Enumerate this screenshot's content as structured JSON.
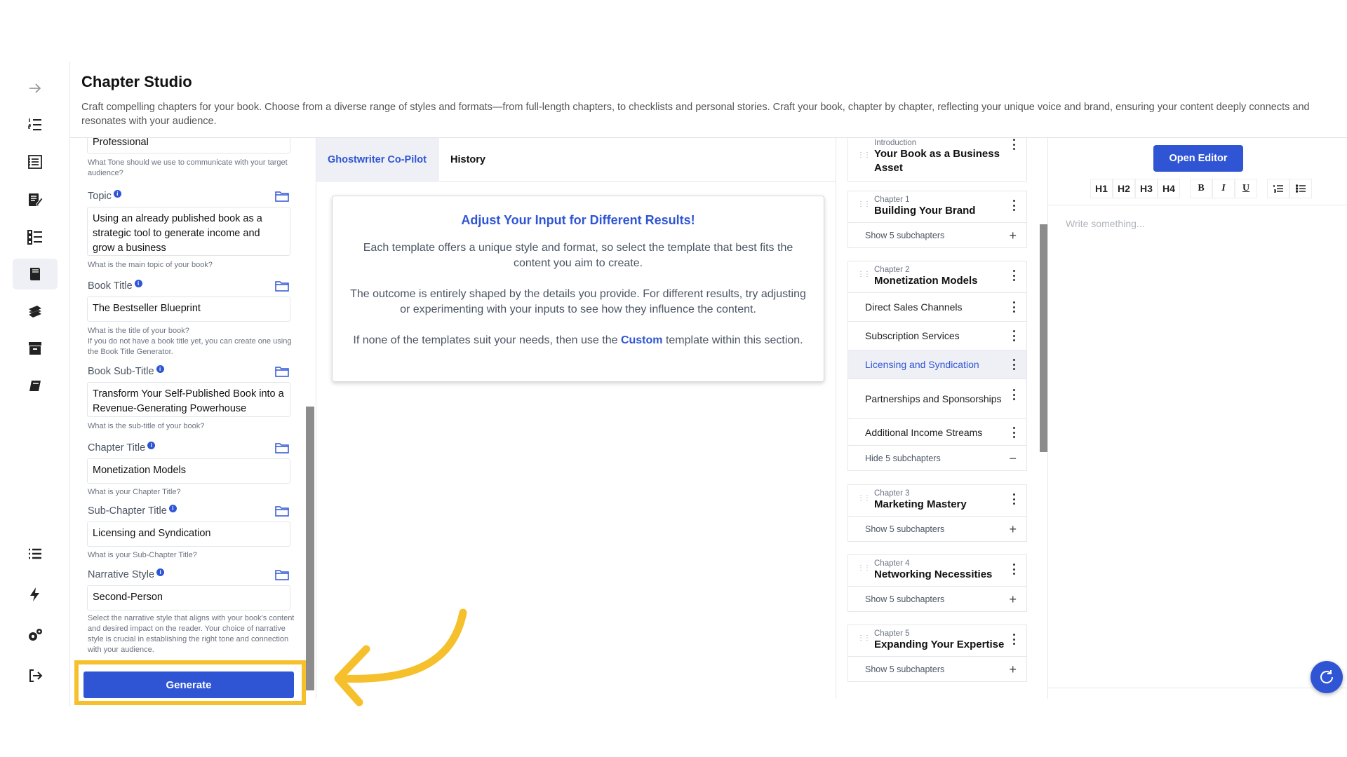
{
  "header": {
    "title": "Chapter Studio",
    "description": "Craft compelling chapters for your book. Choose from a diverse range of styles and formats—from full-length chapters, to checklists and personal stories. Craft your book, chapter by chapter, reflecting your unique voice and brand, ensuring your content deeply connects and resonates with your audience."
  },
  "sidebar": {
    "icons": [
      "arrow-right-icon",
      "numbered-list-icon",
      "document-list-icon",
      "edit-document-icon",
      "checklist-icon",
      "book-open-icon",
      "books-stack-icon",
      "archive-icon",
      "book-icon",
      "menu-list-icon",
      "lightning-icon",
      "settings-icon",
      "logout-icon"
    ]
  },
  "form": {
    "tone": {
      "value": "Professional",
      "hint": "What Tone should we use to communicate with your target audience?"
    },
    "topic": {
      "label": "Topic",
      "value": "Using an already published book as a strategic tool to generate income and grow a business",
      "hint": "What is the main topic of your book?"
    },
    "book_title": {
      "label": "Book Title",
      "value": "The Bestseller Blueprint",
      "hint": "What is the title of your book?",
      "hint2": "If you do not have a book title yet, you can create one using the Book Title Generator."
    },
    "book_subtitle": {
      "label": "Book Sub-Title",
      "value": "Transform Your Self-Published Book into a Revenue-Generating Powerhouse",
      "hint": "What is the sub-title of your book?"
    },
    "chapter_title": {
      "label": "Chapter Title",
      "value": "Monetization Models",
      "hint": "What is your Chapter Title?"
    },
    "subchapter_title": {
      "label": "Sub-Chapter Title",
      "value": "Licensing and Syndication",
      "hint": "What is your Sub-Chapter Title?"
    },
    "narrative_style": {
      "label": "Narrative Style",
      "value": "Second-Person",
      "hint": "Select the narrative style that aligns with your book's content and desired impact on the reader. Your choice of narrative style is crucial in establishing the right tone and connection with your audience."
    },
    "generate_label": "Generate"
  },
  "center": {
    "tabs": [
      "Ghostwriter Co-Pilot",
      "History"
    ],
    "card": {
      "title": "Adjust Your Input for Different Results!",
      "p1": "Each template offers a unique style and format, so select the template that best fits the content you aim to create.",
      "p2": "The outcome is entirely shaped by the details you provide. For different results, try adjusting or experimenting with your inputs to see how they influence the content.",
      "p3_before": "If none of the templates suit your needs, then use the ",
      "p3_highlight": "Custom",
      "p3_after": " template within this section."
    }
  },
  "outline": {
    "intro": {
      "kicker": "Introduction",
      "title": "Your Book as a Business Asset"
    },
    "ch1": {
      "kicker": "Chapter 1",
      "title": "Building Your Brand",
      "toggle": "Show 5 subchapters"
    },
    "ch2": {
      "kicker": "Chapter 2",
      "title": "Monetization Models",
      "subs": [
        "Direct Sales Channels",
        "Subscription Services",
        "Licensing and Syndication",
        "Partnerships and Sponsorships",
        "Additional Income Streams"
      ],
      "toggle": "Hide 5 subchapters"
    },
    "ch3": {
      "kicker": "Chapter 3",
      "title": "Marketing Mastery",
      "toggle": "Show 5 subchapters"
    },
    "ch4": {
      "kicker": "Chapter 4",
      "title": "Networking Necessities",
      "toggle": "Show 5 subchapters"
    },
    "ch5": {
      "kicker": "Chapter 5",
      "title": "Expanding Your Expertise",
      "toggle": "Show 5 subchapters"
    }
  },
  "editor": {
    "open_label": "Open Editor",
    "toolbar": [
      "H1",
      "H2",
      "H3",
      "H4",
      "B",
      "I",
      "U"
    ],
    "placeholder": "Write something..."
  },
  "colors": {
    "accent": "#2f55d4",
    "highlight": "#f6c02c"
  }
}
